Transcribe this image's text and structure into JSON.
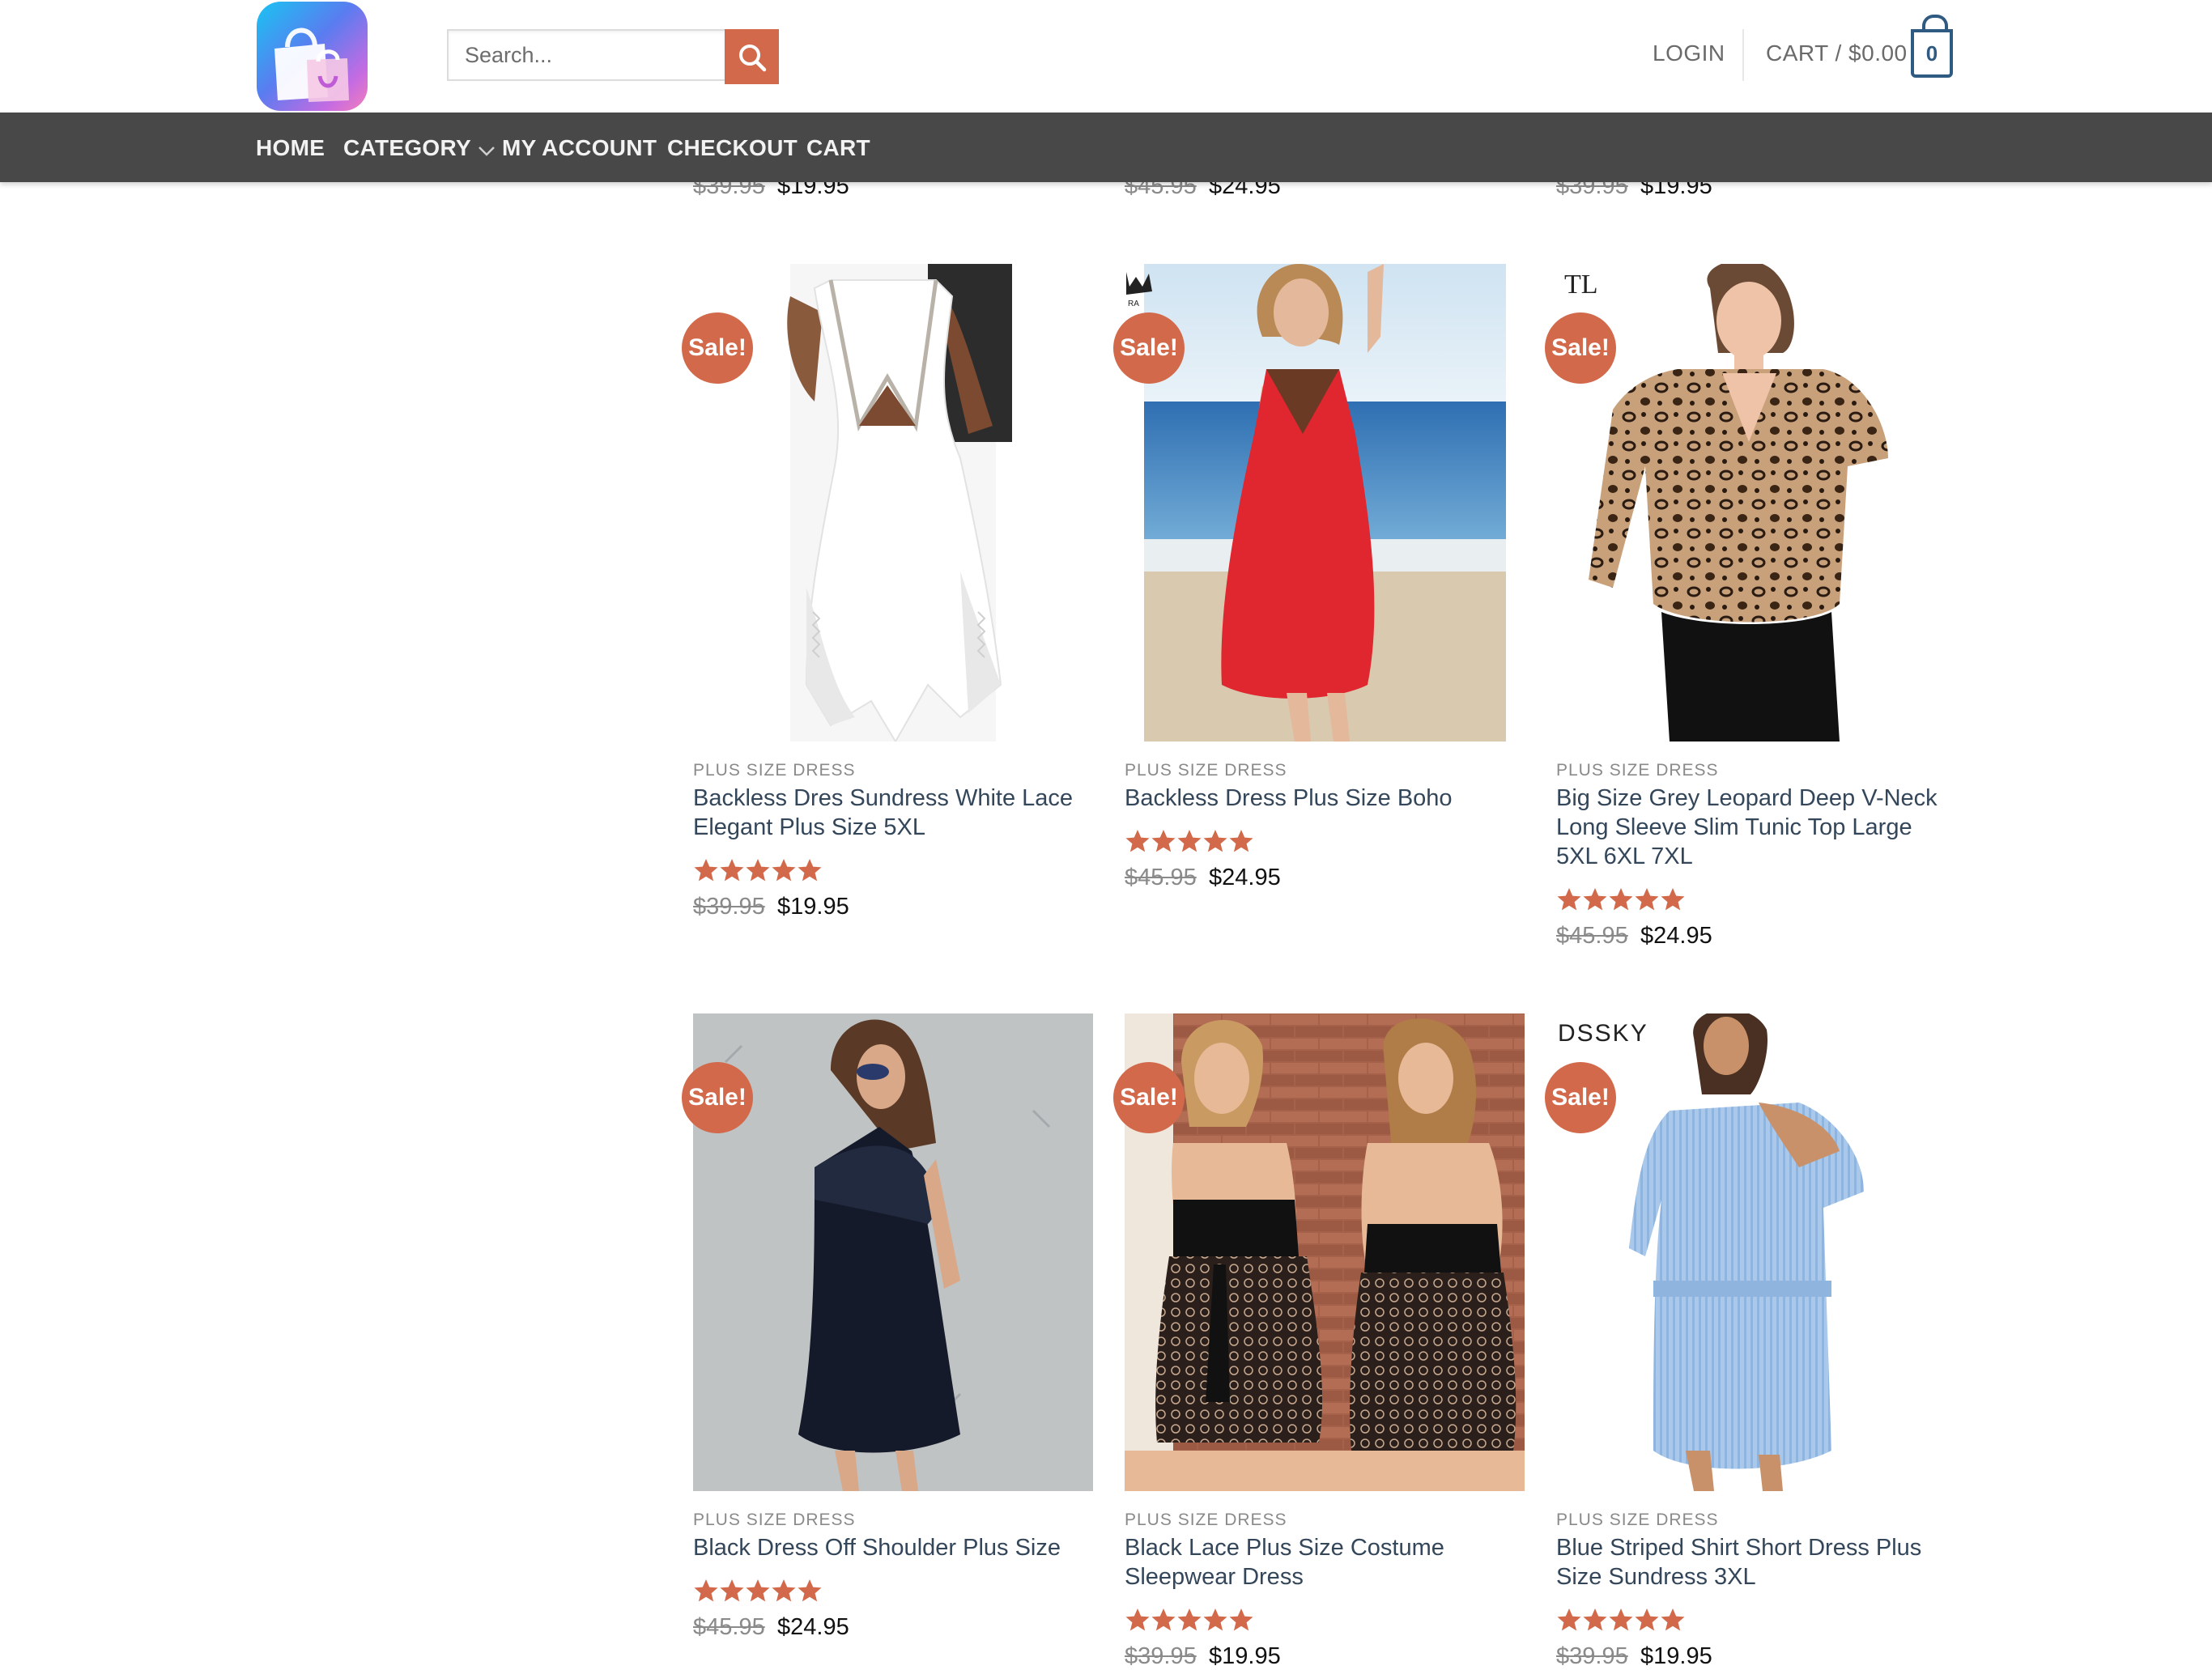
{
  "header": {
    "logo_name": "shopping-bag-logo",
    "search_placeholder": "Search...",
    "login_label": "LOGIN",
    "cart_label": "CART / $0.00",
    "cart_count": "0"
  },
  "nav": {
    "items": [
      {
        "label": "HOME"
      },
      {
        "label": "CATEGORY"
      },
      {
        "label": "MY ACCOUNT"
      },
      {
        "label": "CHECKOUT"
      },
      {
        "label": "CART"
      }
    ]
  },
  "previous_row_prices": [
    {
      "old": "$39.95",
      "new": "$19.95"
    },
    {
      "old": "$45.95",
      "new": "$24.95"
    },
    {
      "old": "$39.95",
      "new": "$19.95"
    }
  ],
  "sale_badge": "Sale!",
  "products": [
    {
      "category": "PLUS SIZE DRESS",
      "title": "Backless Dres Sundress White Lace Elegant Plus Size 5XL",
      "rating": 5,
      "old_price": "$39.95",
      "new_price": "$19.95",
      "image": "white-lace-backless-dress-photo"
    },
    {
      "category": "PLUS SIZE DRESS",
      "title": "Backless Dress Plus Size Boho",
      "rating": 5,
      "old_price": "$45.95",
      "new_price": "$24.95",
      "image": "red-boho-dress-beach-photo",
      "brand_mark": "crown-logo"
    },
    {
      "category": "PLUS SIZE DRESS",
      "title": "Big Size Grey Leopard Deep V-Neck Long Sleeve Slim Tunic Top Large 5XL 6XL 7XL",
      "rating": 5,
      "old_price": "$45.95",
      "new_price": "$24.95",
      "image": "leopard-tunic-top-photo",
      "brand_mark": "TL"
    },
    {
      "category": "PLUS SIZE DRESS",
      "title": "Black Dress Off Shoulder Plus Size",
      "rating": 5,
      "old_price": "$45.95",
      "new_price": "$24.95",
      "image": "black-ruffle-dress-photo"
    },
    {
      "category": "PLUS SIZE DRESS",
      "title": "Black Lace Plus Size Costume Sleepwear Dress",
      "rating": 5,
      "old_price": "$39.95",
      "new_price": "$19.95",
      "image": "black-lace-sleepwear-photo"
    },
    {
      "category": "PLUS SIZE DRESS",
      "title": "Blue Striped Shirt Short Dress Plus Size Sundress 3XL",
      "rating": 5,
      "old_price": "$39.95",
      "new_price": "$19.95",
      "image": "blue-striped-shirt-dress-photo",
      "brand_mark": "DSSKY"
    }
  ],
  "colors": {
    "accent": "#d2694a",
    "nav_bg": "#484848",
    "link": "#33465a",
    "cart_blue": "#2f5b82"
  }
}
